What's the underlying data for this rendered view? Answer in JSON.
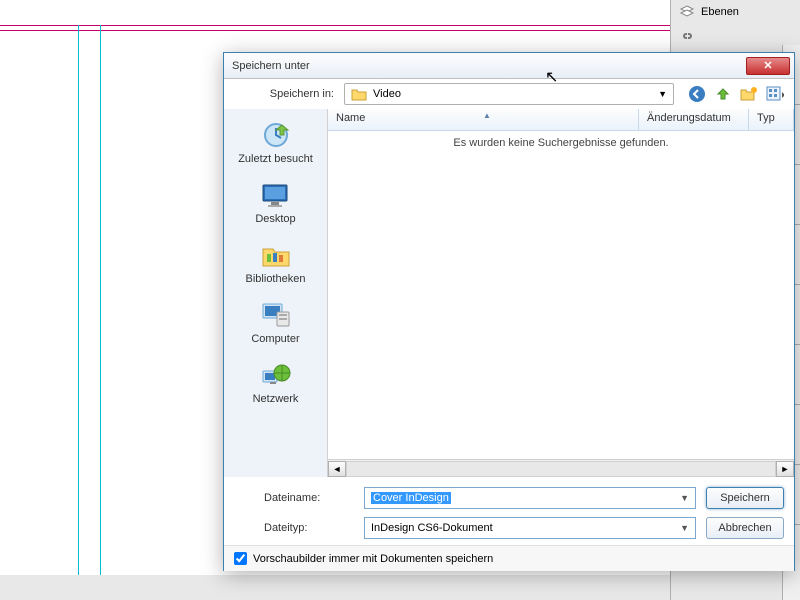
{
  "rightPanel": {
    "ebenen": "Ebenen"
  },
  "dialog": {
    "title": "Speichern unter",
    "saveInLabel": "Speichern in:",
    "folder": "Video",
    "sidebar": {
      "recent": "Zuletzt besucht",
      "desktop": "Desktop",
      "libraries": "Bibliotheken",
      "computer": "Computer",
      "network": "Netzwerk"
    },
    "columns": {
      "name": "Name",
      "date": "Änderungsdatum",
      "type": "Typ"
    },
    "emptyMsg": "Es wurden keine Suchergebnisse gefunden.",
    "filenameLabel": "Dateiname:",
    "filename": "Cover InDesign",
    "filetypeLabel": "Dateityp:",
    "filetype": "InDesign CS6-Dokument",
    "saveBtn": "Speichern",
    "cancelBtn": "Abbrechen",
    "thumbCheck": "Vorschaubilder immer mit Dokumenten speichern"
  }
}
